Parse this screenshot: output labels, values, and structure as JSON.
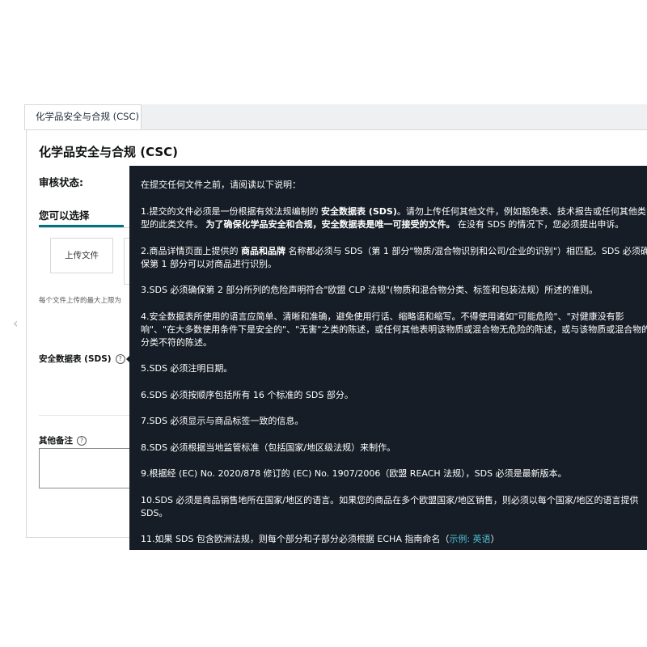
{
  "tab": {
    "label": "化学品安全与合规 (CSC)"
  },
  "panel": {
    "title": "化学品安全与合规 (CSC)",
    "review_status_label": "审核状态:",
    "choose_label": "您可以选择",
    "upload_label": "上传文件",
    "max_size_note": "每个文件上传的最大上限为",
    "sds_label": "安全数据表 (SDS)",
    "other_notes_label": "其他备注"
  },
  "tooltip": {
    "intro": "在提交任何文件之前，请阅读以下说明：",
    "item1_a": "1.提交的文件必须是一份根据有效法规编制的 ",
    "item1_b": "安全数据表 (SDS)",
    "item1_c": "。请勿上传任何其他文件，例如豁免表、技术报告或任何其他类",
    "item1_d": "型的此类文件。 ",
    "item1_e": "为了确保化学品安全和合规，安全数据表是唯一可接受的文件。",
    "item1_f": " 在没有 SDS 的情况下，您必须提出申诉。",
    "item2_a": "2.商品详情页面上提供的 ",
    "item2_b": "商品和品牌",
    "item2_c": " 名称都必须与 SDS（第 1 部分\"物质/混合物识别和公司/企业的识别\"）相匹配。SDS 必须确",
    "item2_d": "保第 1 部分可以对商品进行识别。",
    "item3": "3.SDS 必须确保第 2 部分所列的危险声明符合\"欧盟 CLP 法规\"(物质和混合物分类、标签和包装法规）所述的准则。",
    "item4": "4.安全数据表所使用的语言应简单、清晰和准确，避免使用行话、缩略语和缩写。不得使用诸如\"可能危险\"、\"对健康没有影响\"、\"在大多数使用条件下是安全的\"、\"无害\"之类的陈述，或任何其他表明该物质或混合物无危险的陈述，或与该物质或混合物的分类不符的陈述。",
    "item5": "5.SDS 必须注明日期。",
    "item6": "6.SDS 必须按顺序包括所有 16 个标准的 SDS 部分。",
    "item7": "7.SDS 必须显示与商品标签一致的信息。",
    "item8": "8.SDS 必须根据当地监管标准（包括国家/地区级法规）来制作。",
    "item9": "9.根据经 (EC) No. 2020/878 修订的 (EC) No. 1907/2006（欧盟 REACH 法规），SDS 必须是最新版本。",
    "item10": "10.SDS 必须是商品销售地所在国家/地区的语言。如果您的商品在多个欧盟国家/地区销售，则必须以每个国家/地区的语言提供 SDS。",
    "item11_a": "11.如果 SDS 包含欧洲法规，则每个部分和子部分必须根据 ECHA 指南命名（",
    "item11_link": "示例: 英语",
    "item11_b": "）"
  }
}
